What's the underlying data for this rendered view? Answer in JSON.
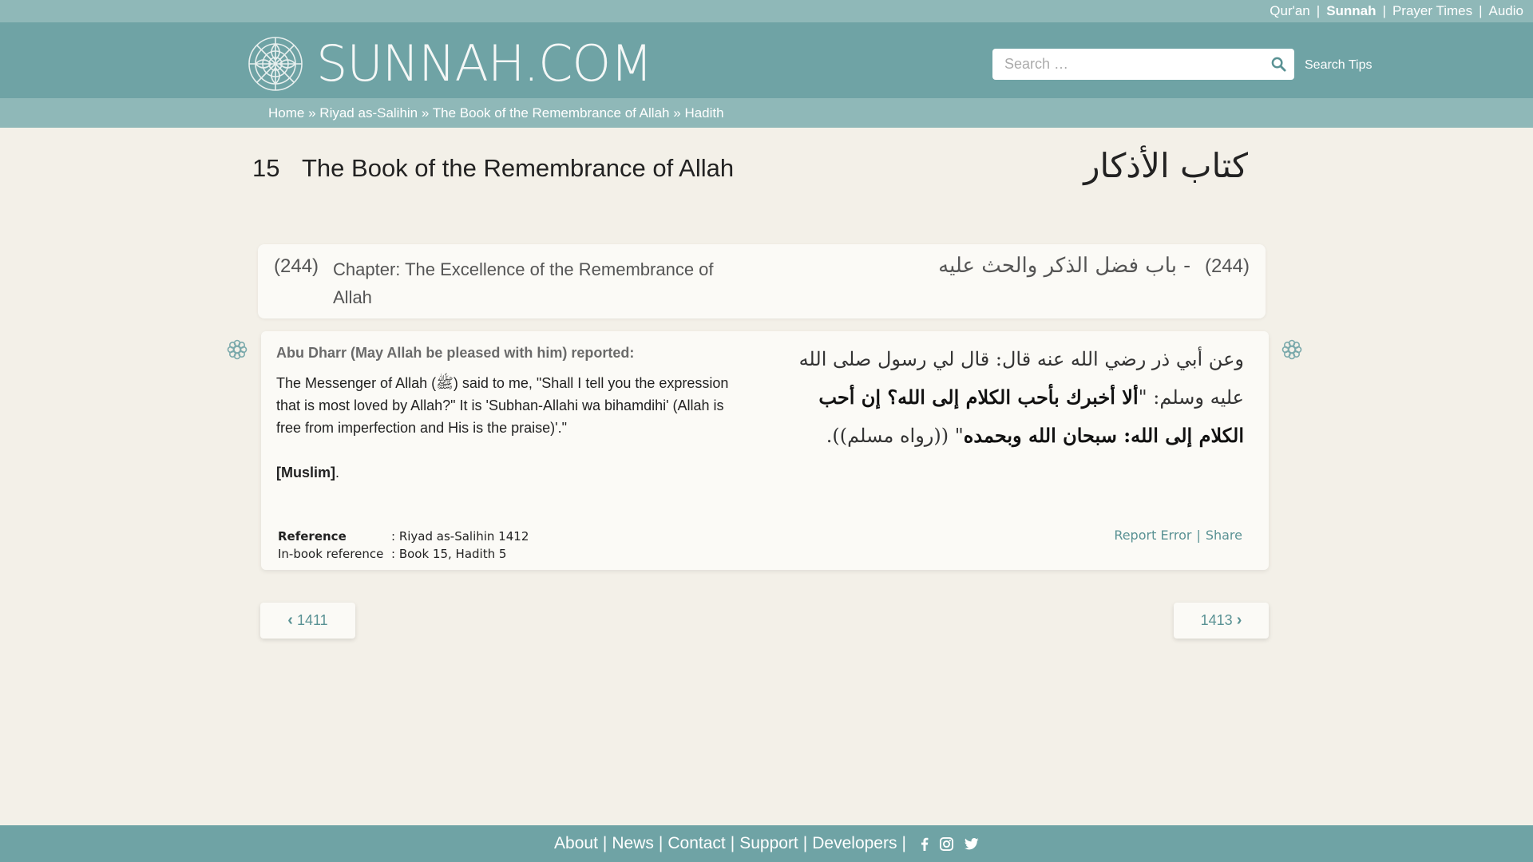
{
  "topnav": {
    "items": [
      {
        "label": "Qur'an"
      },
      {
        "label": "Sunnah"
      },
      {
        "label": "Prayer Times"
      },
      {
        "label": "Audio"
      }
    ]
  },
  "header": {
    "logo_text": "SUNNAH.COM",
    "search_placeholder": "Search …",
    "search_tips": "Search Tips"
  },
  "breadcrumb": {
    "items": [
      "Home",
      "Riyad as-Salihin",
      "The Book of the Remembrance of Allah",
      "Hadith"
    ],
    "sep": "»"
  },
  "book": {
    "number": "15",
    "title": "The Book of the Remembrance of Allah",
    "title_ar": "كتاب الأذكار"
  },
  "chapter": {
    "number": "(244)",
    "title": "Chapter: The Excellence of the Remembrance of Allah",
    "number_ar": "(244)",
    "title_ar": "- باب فضل الذكر والحث عليه"
  },
  "hadith": {
    "narrator": "Abu Dharr (May Allah be pleased with him) reported:",
    "text": "The Messenger of Allah (ﷺ) said to me, \"Shall I tell you the expression that is most loved by Allah?\" It is 'Subhan-Allahi wa bihamdihi' (Allah is free from imperfection and His is the praise)'.\"",
    "grade": "[Muslim]",
    "grade_suffix": ".",
    "arabic_intro": "وعن أبي ذر رضي الله عنه قال: قال لي رسول صلى الله عليه وسلم: \"",
    "arabic_main": "ألا أخبرك بأحب الكلام إلى الله؟ إن أحب الكلام إلى الله: سبحان الله وبحمده",
    "arabic_outro": "\" ((رواه مسلم)).",
    "reference_label": "Reference",
    "reference_value": ": Riyad as-Salihin 1412",
    "inbook_label": "In-book reference",
    "inbook_value": ": Book 15, Hadith 5",
    "report_error": "Report Error",
    "action_sep": "|",
    "share": "Share"
  },
  "pager": {
    "prev": "1411",
    "next": "1413"
  },
  "footer": {
    "links": [
      "About",
      "News",
      "Contact",
      "Support",
      "Developers"
    ],
    "sep": "|"
  },
  "colors": {
    "header_bg": "#6fa3a5",
    "strip_bg": "#8fb8b8",
    "page_bg": "#f3f0e8",
    "link": "#5a9294"
  },
  "icons": [
    "logo-flower-icon",
    "search-icon",
    "flower-icon",
    "chevron-left-icon",
    "chevron-right-icon",
    "facebook-icon",
    "instagram-icon",
    "twitter-icon"
  ]
}
